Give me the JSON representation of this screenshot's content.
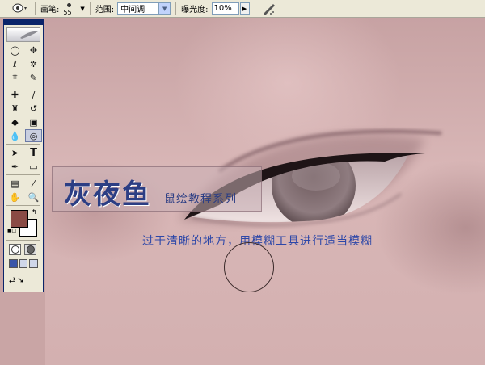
{
  "options_bar": {
    "brush_label": "画笔:",
    "brush_size": "55",
    "range_label": "范围:",
    "range_value": "中间调",
    "exposure_label": "曝光度:",
    "exposure_value": "10%"
  },
  "toolbox": {
    "foreground_color": "#8a4b45",
    "background_color": "#ffffff",
    "active_tool": "burn-tool"
  },
  "canvas": {
    "watermark_title": "灰夜鱼",
    "watermark_subtitle": "鼠绘教程系列",
    "annotation": "过于清晰的地方，用模糊工具进行适当模糊"
  }
}
